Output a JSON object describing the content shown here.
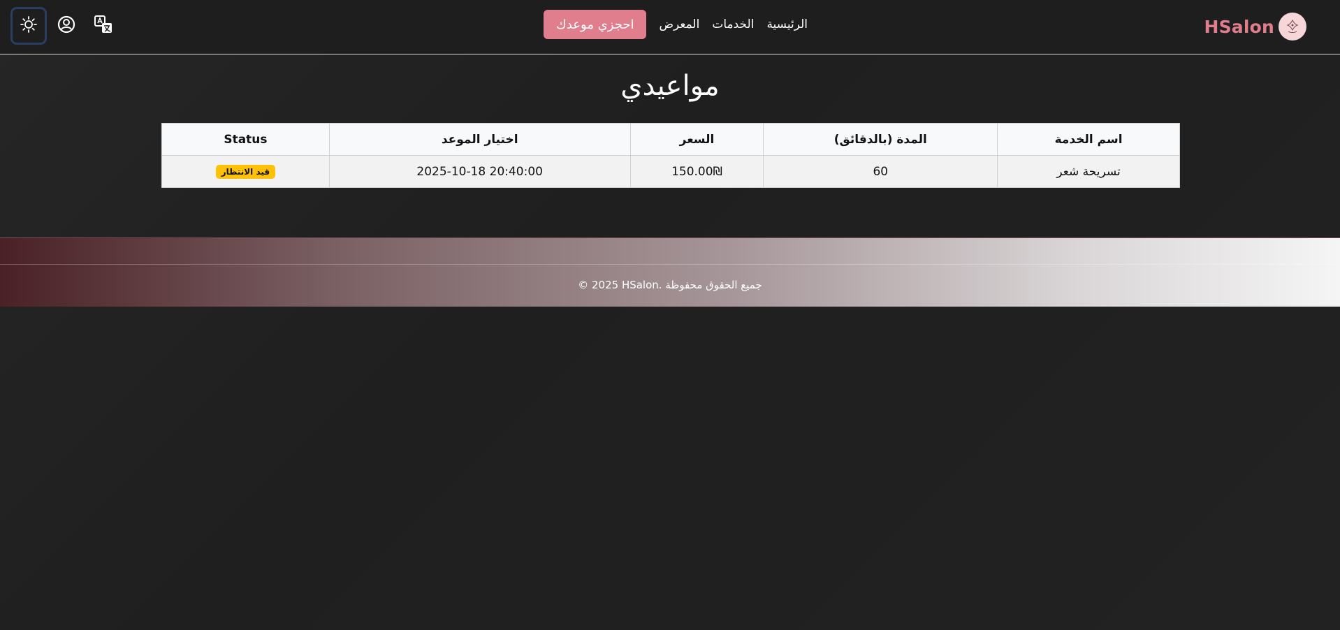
{
  "brand": {
    "name": "HSalon",
    "logo_icon": "salon-logo-icon"
  },
  "nav": {
    "links": [
      "الرئيسية",
      "الخدمات",
      "المعرض"
    ],
    "book_button": "احجزي موعدك"
  },
  "toolbar": {
    "translate_icon": "translate-icon",
    "account_icon": "user-circle-icon",
    "theme_icon": "sun-icon"
  },
  "page": {
    "title": "مواعيدي"
  },
  "table": {
    "headers": [
      "اسم الخدمة",
      "المدة (بالدقائق)",
      "السعر",
      "اختيار الموعد",
      "Status"
    ],
    "rows": [
      {
        "service": "تسريحة شعر",
        "duration": "60",
        "price": "150.00₪",
        "datetime": "2025-10-18 20:40:00",
        "status": "قيد الانتظار"
      }
    ]
  },
  "colors": {
    "accent": "#e07e8e",
    "badge": "#ffc107",
    "theme_focus": "#2a3d63"
  },
  "footer": {
    "text": "© 2025 HSalon. جميع الحقوق محفوظة"
  }
}
